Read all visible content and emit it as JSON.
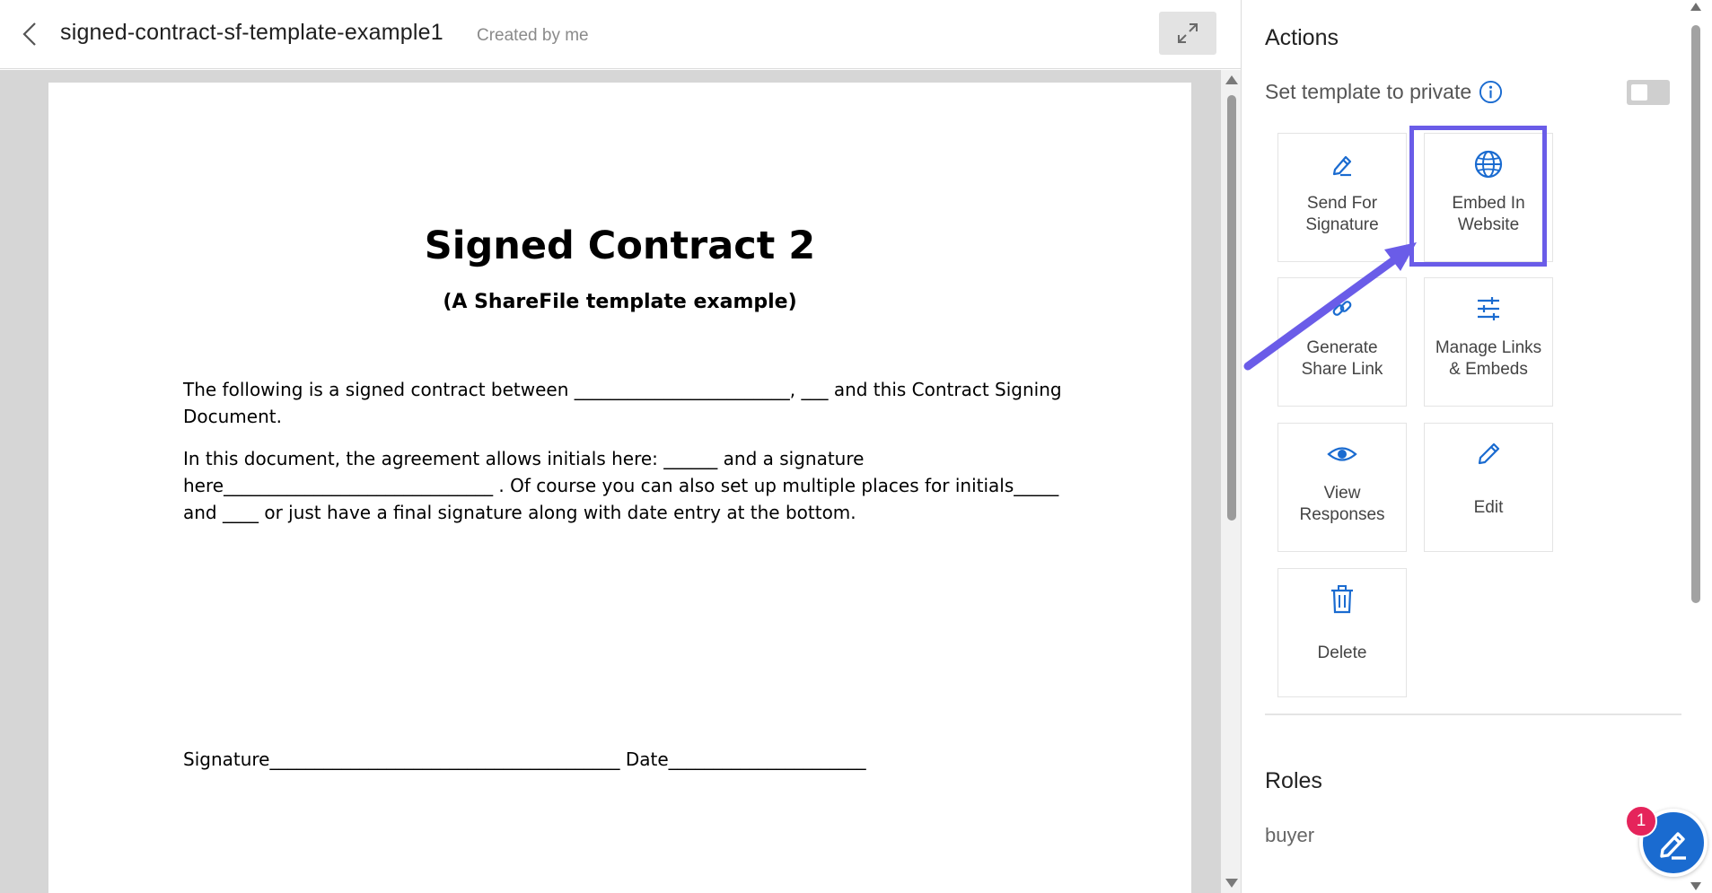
{
  "header": {
    "title": "signed-contract-sf-template-example1",
    "created_by": "Created by me"
  },
  "document": {
    "heading": "Signed Contract 2",
    "subheading": "(A ShareFile template example)",
    "paragraph1": "The following is a signed contract between ________________________, ___ and this Contract Signing Document.",
    "paragraph2": "In this document, the agreement allows initials here: ______ and a signature here______________________________ . Of course you can also set up multiple places for initials_____ and ____ or just have a final signature along with date entry at the bottom.",
    "signature_line": "Signature_______________________________________ Date______________________"
  },
  "actions": {
    "title": "Actions",
    "private_label": "Set template to private",
    "tiles": [
      {
        "label": "Send For Signature",
        "icon": "signature-pen-icon"
      },
      {
        "label": "Embed In Website",
        "icon": "globe-icon"
      },
      {
        "label": "Generate Share Link",
        "icon": "link-icon"
      },
      {
        "label": "Manage Links & Embeds",
        "icon": "sliders-icon"
      },
      {
        "label": "View Responses",
        "icon": "eye-icon"
      },
      {
        "label": "Edit",
        "icon": "pencil-icon"
      },
      {
        "label": "Delete",
        "icon": "trash-icon"
      }
    ]
  },
  "roles": {
    "title": "Roles",
    "items": [
      "buyer"
    ]
  },
  "fab": {
    "badge": "1"
  },
  "colors": {
    "accent_blue": "#1a6bd0",
    "highlight_purple": "#6a5ce8",
    "badge_red": "#e5245b"
  }
}
